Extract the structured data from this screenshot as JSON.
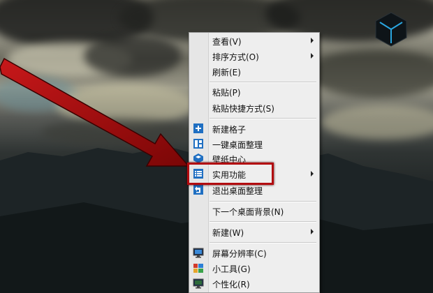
{
  "menu": {
    "items": [
      {
        "label": "查看(V)",
        "submenu": true
      },
      {
        "label": "排序方式(O)",
        "submenu": true
      },
      {
        "label": "刷新(E)",
        "submenu": false
      },
      {
        "label": "粘贴(P)",
        "submenu": false
      },
      {
        "label": "粘贴快捷方式(S)",
        "submenu": false
      },
      {
        "label": "新建格子",
        "submenu": false,
        "icon": "plus-icon"
      },
      {
        "label": "一键桌面整理",
        "submenu": false,
        "icon": "grid-layout-icon"
      },
      {
        "label": "壁纸中心",
        "submenu": false,
        "icon": "wallpaper-cube-icon"
      },
      {
        "label": "实用功能",
        "submenu": true,
        "icon": "list-icon"
      },
      {
        "label": "退出桌面整理",
        "submenu": false,
        "icon": "exit-icon"
      },
      {
        "label": "下一个桌面背景(N)",
        "submenu": false
      },
      {
        "label": "新建(W)",
        "submenu": true
      },
      {
        "label": "屏幕分辨率(C)",
        "submenu": false,
        "icon": "monitor-icon"
      },
      {
        "label": "小工具(G)",
        "submenu": false,
        "icon": "gadgets-icon"
      },
      {
        "label": "个性化(R)",
        "submenu": false,
        "icon": "personalize-icon"
      }
    ]
  },
  "colors": {
    "highlight": "#b20c10",
    "menu_bg": "#eeeeee",
    "icon_blue": "#1f6fc2"
  }
}
